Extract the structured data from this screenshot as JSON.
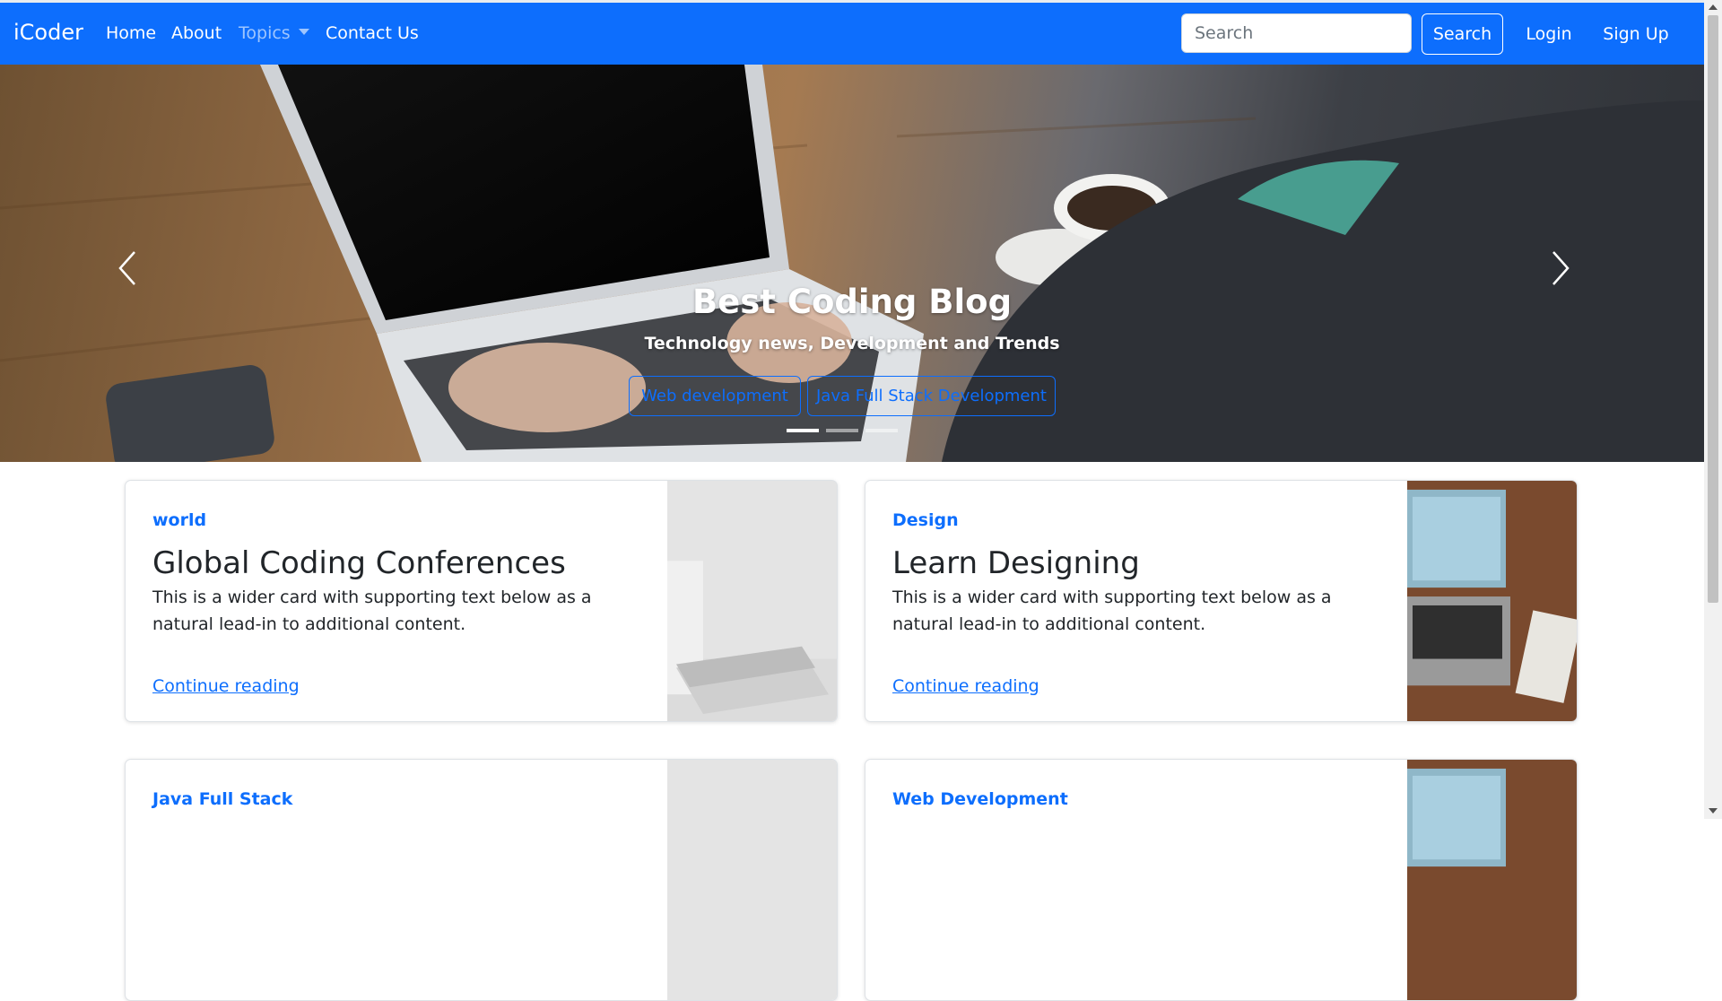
{
  "navbar": {
    "brand": "iCoder",
    "links": [
      "Home",
      "About",
      "Topics",
      "Contact Us"
    ],
    "search_placeholder": "Search",
    "search_button": "Search",
    "login": "Login",
    "signup": "Sign Up",
    "color": "#0d6efd"
  },
  "hero": {
    "title": "Best Coding Blog",
    "subtitle": "Technology news, Development and Trends",
    "buttons": [
      "Web development",
      "Java Full Stack Development"
    ],
    "prev_icon": "chevron-left-icon",
    "next_icon": "chevron-right-icon",
    "slide_count": 3,
    "active_slide": 1
  },
  "cards": [
    {
      "category": "world",
      "title": "Global Coding Conferences",
      "text": "This is a wider card with supporting text below as a natural lead-in to additional content.",
      "link": "Continue reading"
    },
    {
      "category": "Design",
      "title": "Learn Designing",
      "text": "This is a wider card with supporting text below as a natural lead-in to additional content.",
      "link": "Continue reading"
    },
    {
      "category": "Java Full Stack"
    },
    {
      "category": "Web Development"
    }
  ]
}
